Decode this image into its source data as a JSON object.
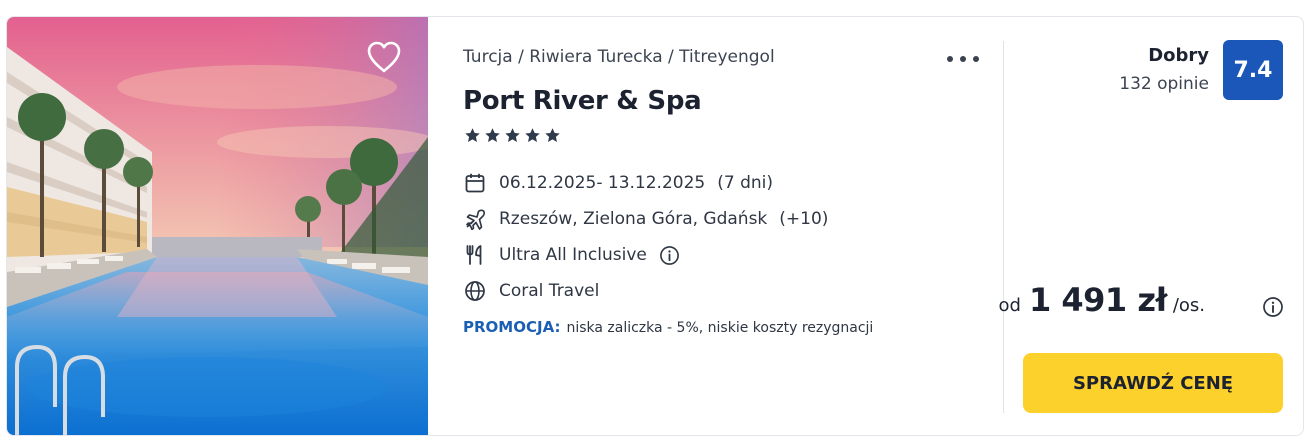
{
  "hotel": {
    "breadcrumb": "Turcja / Riwiera Turecka / Titreyengol",
    "name": "Port River & Spa",
    "stars": 5,
    "dates": "06.12.2025- 13.12.2025",
    "duration": "(7 dni)",
    "departures": "Rzeszów, Zielona Góra, Gdańsk",
    "departures_more": "(+10)",
    "board": "Ultra All Inclusive",
    "operator": "Coral Travel",
    "promo_label": "PROMOCJA:",
    "promo_text": "niska zaliczka - 5%, niskie koszty rezygnacji"
  },
  "rating": {
    "word": "Dobry",
    "reviews": "132 opinie",
    "score": "7.4"
  },
  "price": {
    "prefix": "od",
    "amount": "1 491 zł",
    "suffix": "/os."
  },
  "cta_label": "SPRAWDŹ CENĘ",
  "icons": {
    "favorite": "heart-icon",
    "more": "more-dots-icon",
    "dates": "calendar-icon",
    "departures": "plane-icon",
    "board": "cutlery-icon",
    "operator": "globe-icon",
    "info": "info-icon"
  },
  "colors": {
    "score_bg": "#1a57b9",
    "cta_bg": "#fcd12c",
    "promo": "#1b5fb4",
    "star": "#2f3a4d"
  }
}
